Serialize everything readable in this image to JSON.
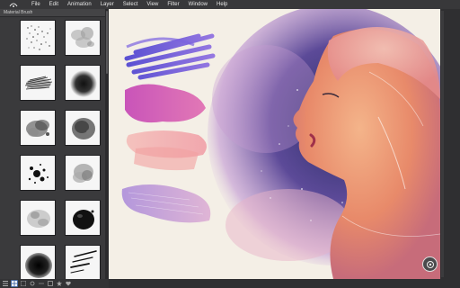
{
  "menubar": {
    "logo_icon": "app-logo-icon",
    "items": [
      "File",
      "Edit",
      "Animation",
      "Layer",
      "Select",
      "View",
      "Filter",
      "Window",
      "Help"
    ]
  },
  "panel": {
    "title": "Material Brush",
    "thumb_icons": [
      "spray-dots-brush",
      "smudge-brush",
      "texture-hatch-brush",
      "soft-blob-brush",
      "watercolor-splash-brush",
      "dark-sponge-brush",
      "ink-splatter-brush",
      "grey-cloud-brush",
      "light-ink-brush",
      "black-stamp-brush",
      "wet-blob-brush",
      "stroke-lines-brush"
    ]
  },
  "bottombar": {
    "buttons": [
      "list-view-icon",
      "grid-view-icon",
      "large-grid-icon",
      "settings-icon",
      "menu-icon",
      "properties-icon",
      "star-icon",
      "heart-icon"
    ]
  },
  "canvas": {
    "content": "watercolor-portrait-artwork",
    "accent_colors": [
      "#6a4fd8",
      "#d04fb5",
      "#f2a3a8",
      "#b08ad8",
      "#2a2f6a",
      "#e8a57a"
    ]
  },
  "fab": {
    "icon": "camera-share-icon"
  }
}
